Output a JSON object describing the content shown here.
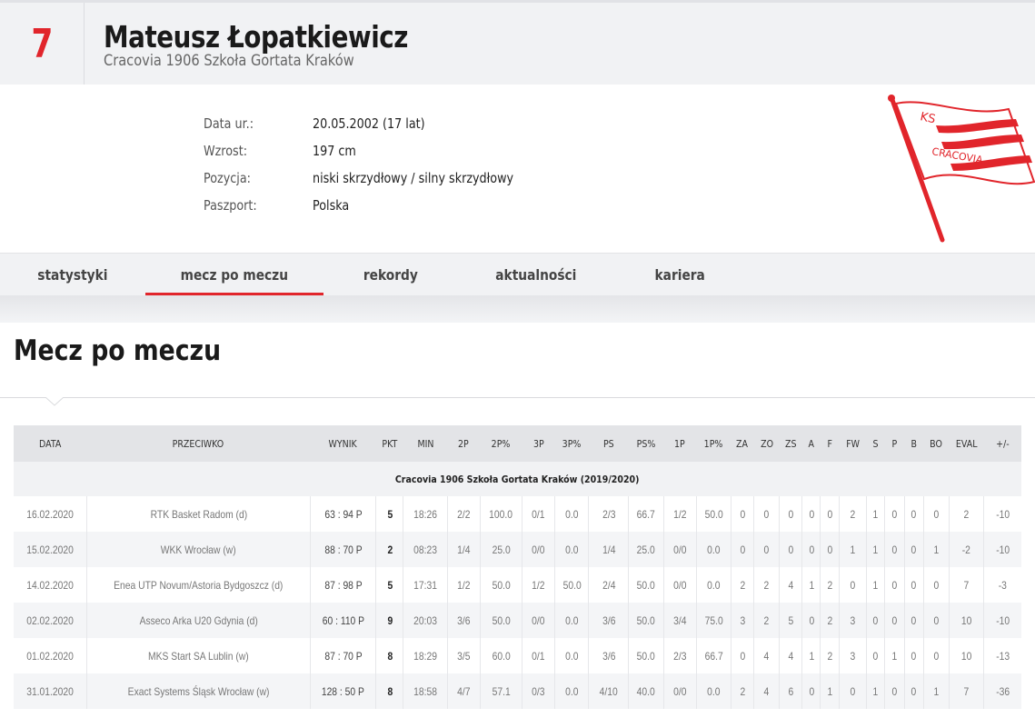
{
  "player": {
    "number": "7",
    "name": "Mateusz Łopatkiewicz",
    "team": "Cracovia 1906 Szkoła Gortata Kraków"
  },
  "info": [
    {
      "label": "Data ur.:",
      "value": "20.05.2002 (17 lat)"
    },
    {
      "label": "Wzrost:",
      "value": "197 cm"
    },
    {
      "label": "Pozycja:",
      "value": "niski skrzydłowy / silny skrzydłowy"
    },
    {
      "label": "Paszport:",
      "value": "Polska"
    }
  ],
  "logo": {
    "text_top": "KS",
    "text_bottom": "CRACOVIA",
    "color": "#e1252b"
  },
  "tabs": [
    "statystyki",
    "mecz po meczu",
    "rekordy",
    "aktualności",
    "kariera"
  ],
  "active_tab": "mecz po meczu",
  "section_title": "Mecz po meczu",
  "table": {
    "headers": [
      "DATA",
      "PRZECIWKO",
      "WYNIK",
      "PKT",
      "MIN",
      "2P",
      "2P%",
      "3P",
      "3P%",
      "PS",
      "PS%",
      "1P",
      "1P%",
      "ZA",
      "ZO",
      "ZS",
      "A",
      "F",
      "FW",
      "S",
      "P",
      "B",
      "BO",
      "EVAL",
      "+/-"
    ],
    "season_label": "Cracovia 1906 Szkoła Gortata Kraków (2019/2020)",
    "rows": [
      [
        "16.02.2020",
        "RTK Basket Radom (d)",
        "63 : 94 P",
        "5",
        "18:26",
        "2/2",
        "100.0",
        "0/1",
        "0.0",
        "2/3",
        "66.7",
        "1/2",
        "50.0",
        "0",
        "0",
        "0",
        "0",
        "0",
        "2",
        "1",
        "0",
        "0",
        "0",
        "2",
        "-10"
      ],
      [
        "15.02.2020",
        "WKK Wrocław (w)",
        "88 : 70 P",
        "2",
        "08:23",
        "1/4",
        "25.0",
        "0/0",
        "0.0",
        "1/4",
        "25.0",
        "0/0",
        "0.0",
        "0",
        "0",
        "0",
        "0",
        "0",
        "1",
        "1",
        "0",
        "0",
        "1",
        "-2",
        "-10"
      ],
      [
        "14.02.2020",
        "Enea UTP Novum/Astoria Bydgoszcz (d)",
        "87 : 98 P",
        "5",
        "17:31",
        "1/2",
        "50.0",
        "1/2",
        "50.0",
        "2/4",
        "50.0",
        "0/0",
        "0.0",
        "2",
        "2",
        "4",
        "1",
        "2",
        "0",
        "1",
        "0",
        "0",
        "0",
        "7",
        "-3"
      ],
      [
        "02.02.2020",
        "Asseco Arka U20 Gdynia (d)",
        "60 : 110 P",
        "9",
        "20:03",
        "3/6",
        "50.0",
        "0/0",
        "0.0",
        "3/6",
        "50.0",
        "3/4",
        "75.0",
        "3",
        "2",
        "5",
        "0",
        "2",
        "3",
        "0",
        "0",
        "0",
        "0",
        "10",
        "-10"
      ],
      [
        "01.02.2020",
        "MKS Start SA Lublin (w)",
        "87 : 70 P",
        "8",
        "18:29",
        "3/5",
        "60.0",
        "0/1",
        "0.0",
        "3/6",
        "50.0",
        "2/3",
        "66.7",
        "0",
        "4",
        "4",
        "1",
        "2",
        "3",
        "0",
        "1",
        "0",
        "0",
        "10",
        "-13"
      ],
      [
        "31.01.2020",
        "Exact Systems Śląsk Wrocław (w)",
        "128 : 50 P",
        "8",
        "18:58",
        "4/7",
        "57.1",
        "0/3",
        "0.0",
        "4/10",
        "40.0",
        "0/0",
        "0.0",
        "2",
        "4",
        "6",
        "0",
        "1",
        "0",
        "1",
        "0",
        "0",
        "1",
        "7",
        "-36"
      ]
    ]
  }
}
